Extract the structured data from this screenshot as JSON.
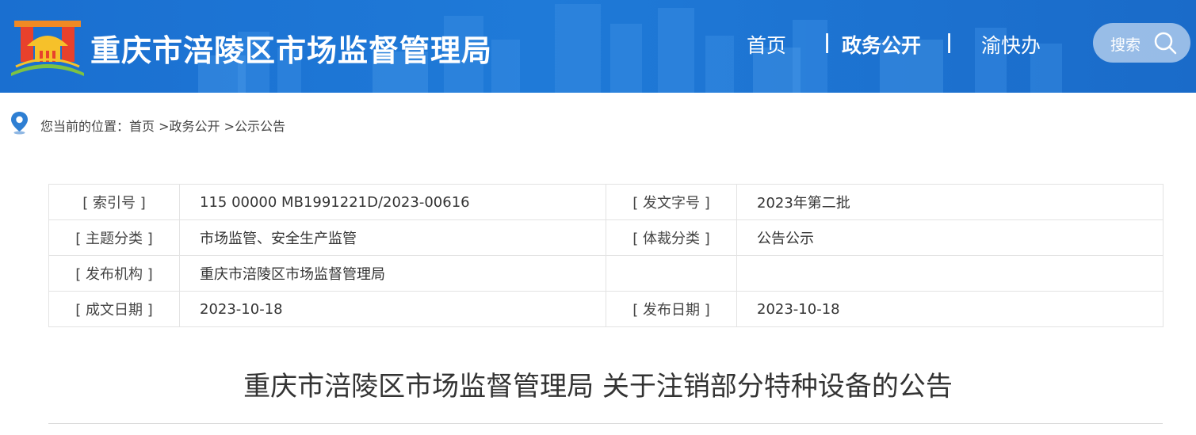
{
  "header": {
    "site_title": "重庆市涪陵区市场监督管理局",
    "nav": {
      "home": "首页",
      "separator": "|",
      "gov_open": "政务公开",
      "yukuaiban": "渝快办"
    },
    "search_label": "搜索",
    "logo_icon": "city-gate-logo",
    "colors": {
      "header_bg": "#1f7ad8",
      "text": "#ffffff"
    }
  },
  "breadcrumb": {
    "icon": "location-pin-icon",
    "text": "您当前的位置：首页 >政务公开 >公示公告"
  },
  "info_table": {
    "rows": [
      {
        "label1": "[ 索引号 ]",
        "value1": "115 00000 MB1991221D/2023-00616",
        "label2": "[ 发文字号 ]",
        "value2": "2023年第二批"
      },
      {
        "label1": "[ 主题分类 ]",
        "value1": "市场监管、安全生产监管",
        "label2": "[ 体裁分类 ]",
        "value2": "公告公示"
      },
      {
        "label1": "[ 发布机构 ]",
        "value1": "重庆市涪陵区市场监督管理局",
        "label2": "",
        "value2": ""
      },
      {
        "label1": "[ 成文日期 ]",
        "value1": "2023-10-18",
        "label2": "[ 发布日期 ]",
        "value2": "2023-10-18"
      }
    ]
  },
  "document": {
    "title": "重庆市涪陵区市场监督管理局 关于注销部分特种设备的公告"
  }
}
